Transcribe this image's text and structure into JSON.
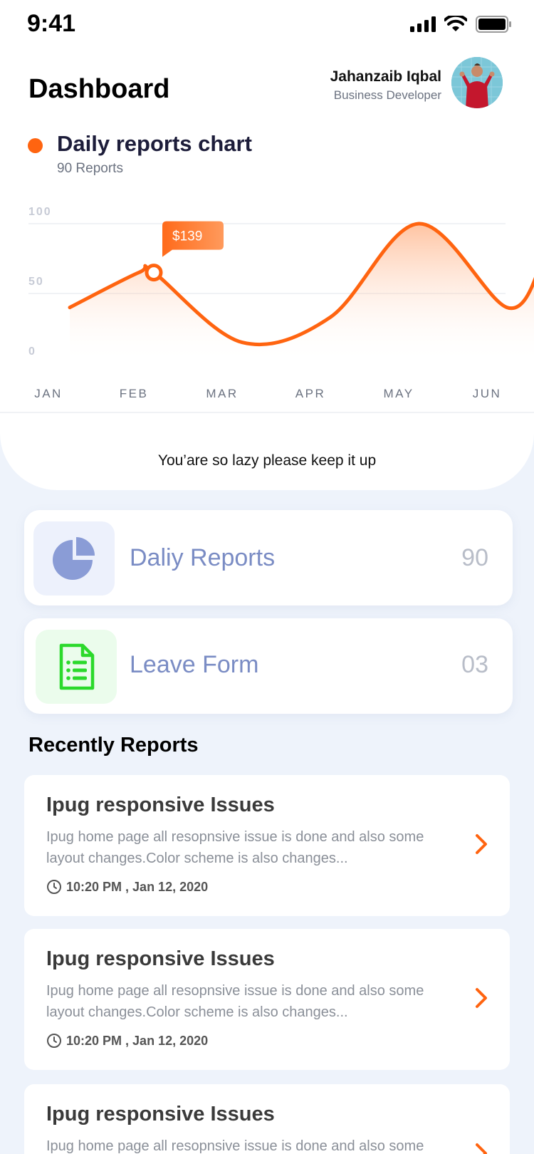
{
  "status_bar": {
    "time": "9:41"
  },
  "header": {
    "title": "Dashboard",
    "user_name": "Jahanzaib Iqbal",
    "user_role": "Business Developer"
  },
  "chart_section": {
    "title": "Daily reports chart",
    "subtitle": "90 Reports",
    "accent_color": "#ff6410"
  },
  "chart_data": {
    "type": "area",
    "x": [
      "JAN",
      "FEB",
      "MAR",
      "APR",
      "MAY",
      "JUN"
    ],
    "series": [
      {
        "values": [
          40,
          65,
          15,
          33,
          100,
          40
        ]
      }
    ],
    "ylim": [
      0,
      100
    ],
    "yticks": [
      "100",
      "50",
      "0"
    ],
    "xlabel": "",
    "ylabel": "",
    "tooltip": {
      "x": "FEB",
      "label": "$139"
    },
    "grid": true,
    "line_color": "#ff6410"
  },
  "motto": "You’are so lazy please keep it up",
  "quick_cards": [
    {
      "label": "Daliy Reports",
      "count": "90",
      "icon": "pie-chart-icon",
      "icon_bg": "#edf1fc",
      "icon_color": "#8a9cd6"
    },
    {
      "label": "Leave Form",
      "count": "03",
      "icon": "document-icon",
      "icon_bg": "#ebfcec",
      "icon_color": "#2bd92b"
    }
  ],
  "recent": {
    "title": "Recently Reports",
    "items": [
      {
        "title": "Ipug responsive Issues",
        "description": "Ipug home page all resopnsive issue is done and also some layout changes.Color scheme is also changes...",
        "time": "10:20 PM , Jan 12, 2020"
      },
      {
        "title": "Ipug responsive Issues",
        "description": "Ipug home page all resopnsive issue is done and also some layout changes.Color scheme is also changes...",
        "time": "10:20 PM , Jan 12, 2020"
      },
      {
        "title": "Ipug responsive Issues",
        "description": "Ipug home page all resopnsive issue is done and also some",
        "time": ""
      }
    ]
  }
}
